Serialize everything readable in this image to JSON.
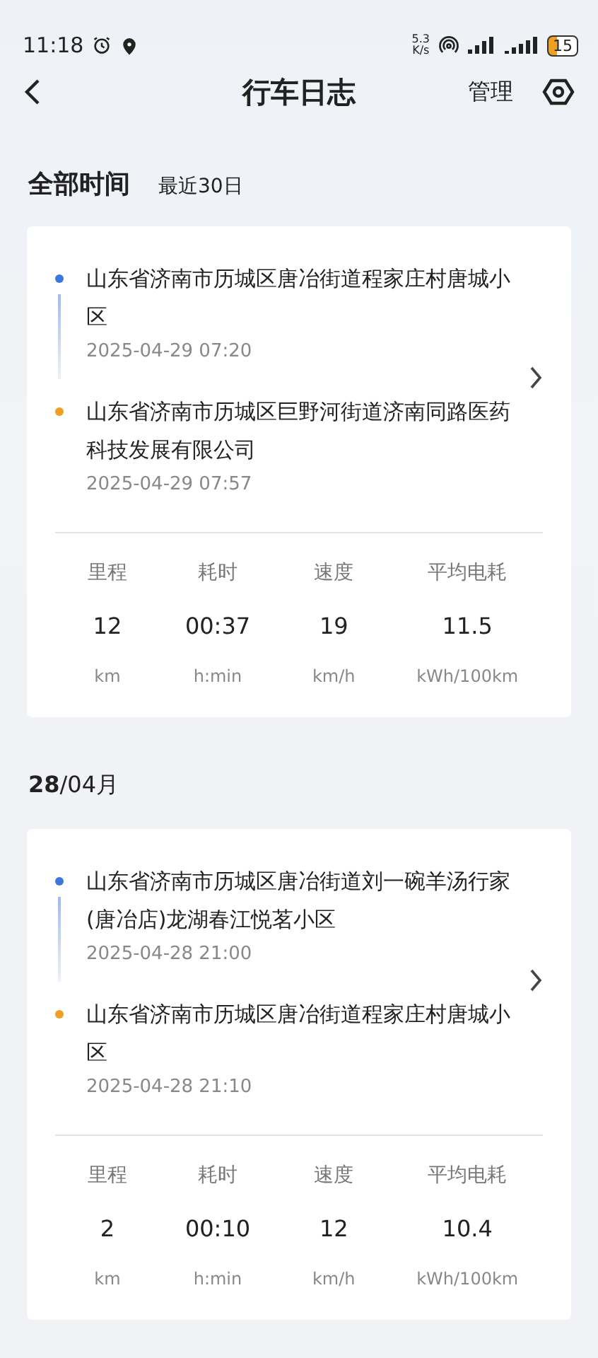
{
  "status_bar": {
    "time": "11:18",
    "net_speed_value": "5.3",
    "net_speed_unit": "K/s",
    "battery": "15"
  },
  "header": {
    "title": "行车日志",
    "manage": "管理"
  },
  "filters": [
    {
      "label": "全部时间",
      "selected": true
    },
    {
      "label": "最近30日",
      "selected": false
    }
  ],
  "groups": [
    {
      "trips": [
        {
          "stops": [
            {
              "address": "山东省济南市历城区唐冶街道程家庄村唐城小区",
              "time": "2025-04-29 07:20",
              "color": "#3a78e0"
            },
            {
              "address": "山东省济南市历城区巨野河街道济南同路医药科技发展有限公司",
              "time": "2025-04-29 07:57",
              "color": "#f0a020"
            }
          ],
          "stats": [
            {
              "label": "里程",
              "value": "12",
              "unit": "km"
            },
            {
              "label": "耗时",
              "value": "00:37",
              "unit": "h:min"
            },
            {
              "label": "速度",
              "value": "19",
              "unit": "km/h"
            },
            {
              "label": "平均电耗",
              "value": "11.5",
              "unit": "kWh/100km"
            }
          ]
        }
      ]
    },
    {
      "date": "**28**/04月",
      "trips": [
        {
          "stops": [
            {
              "address": "山东省济南市历城区唐冶街道刘一碗羊汤行家(唐冶店)龙湖春江悦茗小区",
              "time": "2025-04-28 21:00",
              "color": "#3a78e0"
            },
            {
              "address": "山东省济南市历城区唐冶街道程家庄村唐城小区",
              "time": "2025-04-28 21:10",
              "color": "#f0a020"
            }
          ],
          "stats": [
            {
              "label": "里程",
              "value": "2",
              "unit": "km"
            },
            {
              "label": "耗时",
              "value": "00:10",
              "unit": "h:min"
            },
            {
              "label": "速度",
              "value": "12",
              "unit": "km/h"
            },
            {
              "label": "平均电耗",
              "value": "10.4",
              "unit": "kWh/100km"
            }
          ]
        }
      ]
    }
  ]
}
